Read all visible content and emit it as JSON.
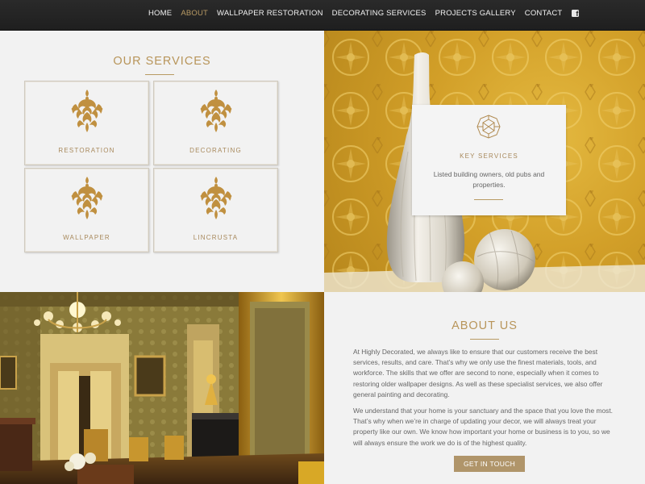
{
  "nav": {
    "items": [
      {
        "label": "HOME"
      },
      {
        "label": "ABOUT"
      },
      {
        "label": "WALLPAPER RESTORATION"
      },
      {
        "label": "DECORATING SERVICES"
      },
      {
        "label": "PROJECTS GALLERY"
      },
      {
        "label": "CONTACT"
      }
    ],
    "active_item": "ABOUT",
    "social_icon": "facebook-icon"
  },
  "services": {
    "title": "OUR SERVICES",
    "cards": [
      {
        "label": "RESTORATION",
        "icon": "damask-ornament-icon"
      },
      {
        "label": "DECORATING",
        "icon": "damask-ornament-icon"
      },
      {
        "label": "WALLPAPER",
        "icon": "damask-ornament-icon"
      },
      {
        "label": "LINCRUSTA",
        "icon": "damask-ornament-icon"
      }
    ]
  },
  "key_services": {
    "icon": "octagon-gem-icon",
    "title": "KEY SERVICES",
    "text": "Listed building owners, old pubs and properties."
  },
  "about": {
    "title": "ABOUT US",
    "paragraphs": [
      "At Highly Decorated, we always like to ensure that our customers receive the best services, results, and care. That’s why we only use the finest materials, tools, and workforce. The skills that we offer are second to none, especially when it comes to restoring older wallpaper designs. As well as these specialist services, we also offer general painting and decorating.",
      "We understand that your home is your sanctuary and the space that you love the most. That’s why when we’re in charge of updating your decor, we will always treat your property like our own. We know how important your home or business is to you, so we will always ensure the work we do is of the highest quality."
    ],
    "cta_label": "GET IN TOUCH"
  },
  "colors": {
    "accent": "#b8955a",
    "nav_bg": "#222222",
    "button": "#b0956a",
    "panel": "#f2f2f2"
  }
}
